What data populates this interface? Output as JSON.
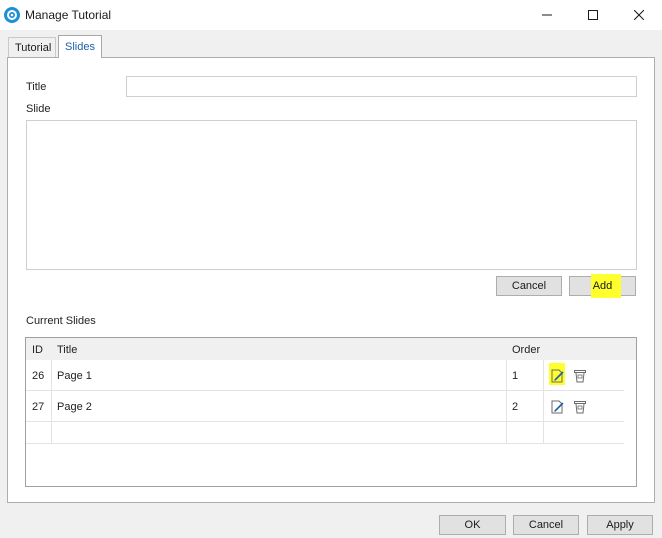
{
  "window": {
    "title": "Manage Tutorial",
    "app_icon": "tutorial-app-icon",
    "controls": [
      "minimize",
      "maximize",
      "close"
    ]
  },
  "tabs": [
    {
      "label": "Tutorial",
      "selected": false
    },
    {
      "label": "Slides",
      "selected": true
    }
  ],
  "form": {
    "title_label": "Title",
    "title_value": "",
    "slide_label": "Slide",
    "slide_value": "",
    "cancel_label": "Cancel",
    "add_label": "Add"
  },
  "current_slides": {
    "label": "Current Slides",
    "columns": [
      "ID",
      "Title",
      "Order"
    ],
    "rows": [
      {
        "id": "26",
        "title": "Page 1",
        "order": "1"
      },
      {
        "id": "27",
        "title": "Page 2",
        "order": "2"
      }
    ],
    "row_actions": [
      "edit-icon",
      "delete-icon"
    ]
  },
  "footer": {
    "ok_label": "OK",
    "cancel_label": "Cancel",
    "apply_label": "Apply"
  },
  "colors": {
    "highlight": "#ffff2e",
    "selected_tab_text": "#1c5fa8",
    "app_icon": "#1e90d6"
  }
}
